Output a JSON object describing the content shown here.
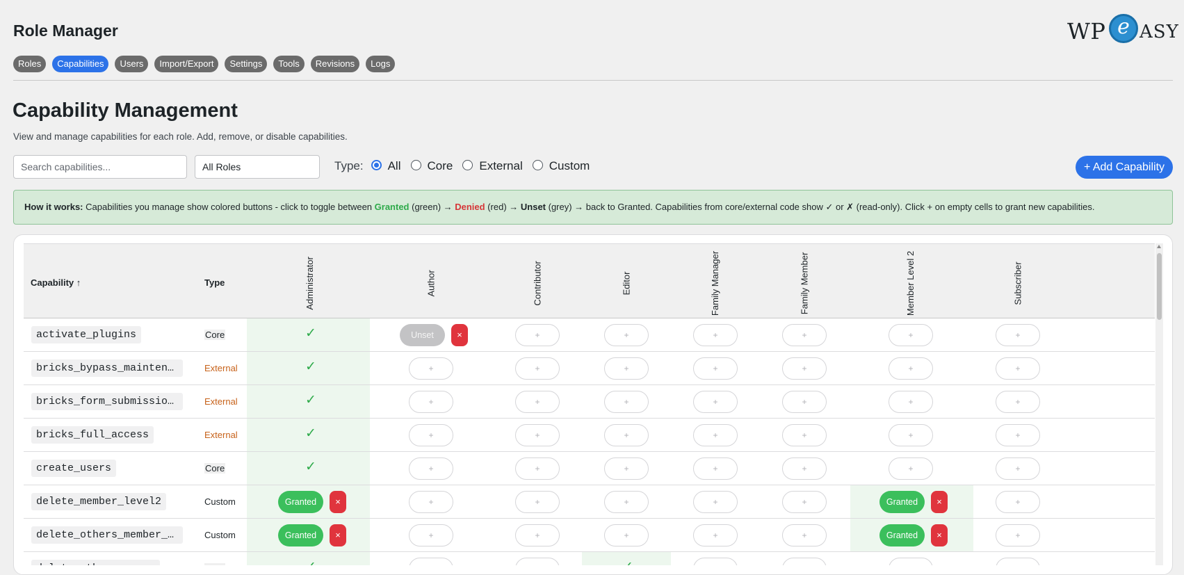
{
  "app": {
    "title": "Role Manager"
  },
  "logo": {
    "left": "WP",
    "mark": "e",
    "right": "ASY"
  },
  "tabs": [
    {
      "label": "Roles",
      "active": false
    },
    {
      "label": "Capabilities",
      "active": true
    },
    {
      "label": "Users",
      "active": false
    },
    {
      "label": "Import/Export",
      "active": false
    },
    {
      "label": "Settings",
      "active": false
    },
    {
      "label": "Tools",
      "active": false
    },
    {
      "label": "Revisions",
      "active": false
    },
    {
      "label": "Logs",
      "active": false
    }
  ],
  "page": {
    "title": "Capability Management",
    "description": "View and manage capabilities for each role. Add, remove, or disable capabilities."
  },
  "filters": {
    "search_placeholder": "Search capabilities...",
    "role_select": "All Roles",
    "type_label": "Type:",
    "type_options": [
      {
        "label": "All",
        "checked": true
      },
      {
        "label": "Core",
        "checked": false
      },
      {
        "label": "External",
        "checked": false
      },
      {
        "label": "Custom",
        "checked": false
      }
    ]
  },
  "add_button": "+ Add Capability",
  "info": {
    "heading": "How it works:",
    "t1": " Capabilities you manage show colored buttons - click to toggle between ",
    "granted": "Granted",
    "t2": " (green) → ",
    "denied": "Denied",
    "t3": " (red) → ",
    "unset": "Unset",
    "t4": " (grey) → back to Granted. Capabilities from core/external code show ✓ or ✗ (read-only). Click + on empty cells to grant new capabilities."
  },
  "table": {
    "col_capability": "Capability ↑",
    "col_type": "Type",
    "roles": [
      "Administrator",
      "Author",
      "Contributor",
      "Editor",
      "Family Manager",
      "Family Member",
      "Member Level 2",
      "Subscriber"
    ],
    "rows": [
      {
        "name": "activate_plugins",
        "type": "Core",
        "cells": [
          {
            "state": "check"
          },
          {
            "state": "Unset"
          },
          {
            "state": "plus"
          },
          {
            "state": "plus"
          },
          {
            "state": "plus"
          },
          {
            "state": "plus"
          },
          {
            "state": "plus"
          },
          {
            "state": "plus"
          }
        ]
      },
      {
        "name": "bricks_bypass_maintenanc…",
        "type": "External",
        "cells": [
          {
            "state": "check"
          },
          {
            "state": "plus"
          },
          {
            "state": "plus"
          },
          {
            "state": "plus"
          },
          {
            "state": "plus"
          },
          {
            "state": "plus"
          },
          {
            "state": "plus"
          },
          {
            "state": "plus"
          }
        ]
      },
      {
        "name": "bricks_form_submission_a…",
        "type": "External",
        "cells": [
          {
            "state": "check"
          },
          {
            "state": "plus"
          },
          {
            "state": "plus"
          },
          {
            "state": "plus"
          },
          {
            "state": "plus"
          },
          {
            "state": "plus"
          },
          {
            "state": "plus"
          },
          {
            "state": "plus"
          }
        ]
      },
      {
        "name": "bricks_full_access",
        "type": "External",
        "cells": [
          {
            "state": "check"
          },
          {
            "state": "plus"
          },
          {
            "state": "plus"
          },
          {
            "state": "plus"
          },
          {
            "state": "plus"
          },
          {
            "state": "plus"
          },
          {
            "state": "plus"
          },
          {
            "state": "plus"
          }
        ]
      },
      {
        "name": "create_users",
        "type": "Core",
        "cells": [
          {
            "state": "check"
          },
          {
            "state": "plus"
          },
          {
            "state": "plus"
          },
          {
            "state": "plus"
          },
          {
            "state": "plus"
          },
          {
            "state": "plus"
          },
          {
            "state": "plus"
          },
          {
            "state": "plus"
          }
        ]
      },
      {
        "name": "delete_member_level2",
        "type": "Custom",
        "cells": [
          {
            "state": "Granted"
          },
          {
            "state": "plus"
          },
          {
            "state": "plus"
          },
          {
            "state": "plus"
          },
          {
            "state": "plus"
          },
          {
            "state": "plus"
          },
          {
            "state": "Granted"
          },
          {
            "state": "plus"
          }
        ]
      },
      {
        "name": "delete_others_member_lev…",
        "type": "Custom",
        "cells": [
          {
            "state": "Granted"
          },
          {
            "state": "plus"
          },
          {
            "state": "plus"
          },
          {
            "state": "plus"
          },
          {
            "state": "plus"
          },
          {
            "state": "plus"
          },
          {
            "state": "Granted"
          },
          {
            "state": "plus"
          }
        ]
      },
      {
        "name": "delete_others_pages",
        "type": "Core",
        "cells": [
          {
            "state": "check"
          },
          {
            "state": "plus"
          },
          {
            "state": "plus"
          },
          {
            "state": "check"
          },
          {
            "state": "plus"
          },
          {
            "state": "plus"
          },
          {
            "state": "plus"
          },
          {
            "state": "plus"
          }
        ]
      }
    ]
  },
  "labels": {
    "unset": "Unset",
    "granted": "Granted",
    "remove": "×",
    "add": "+",
    "check": "✓"
  },
  "colors": {
    "accent": "#2c72e8",
    "granted": "#3bbf5c",
    "denied": "#e0343d",
    "unset": "#c3c3c5",
    "external_type": "#c7621a",
    "granted_cell_bg": "#edf7ee"
  }
}
